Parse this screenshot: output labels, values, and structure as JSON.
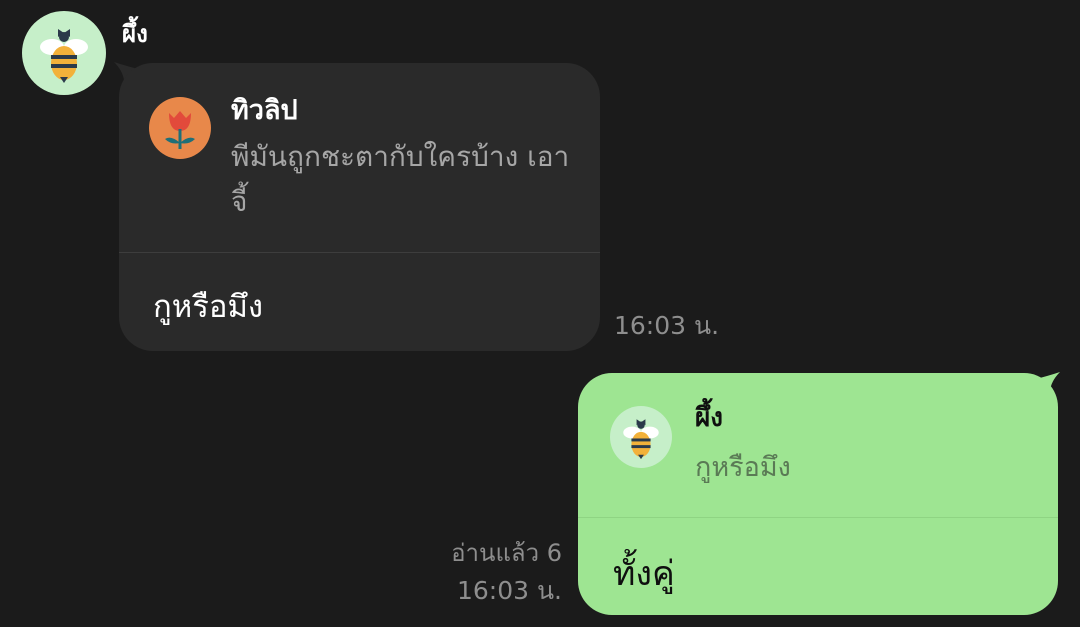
{
  "incoming": {
    "sender": "ผึ้ง",
    "avatar_icon": "bee-icon",
    "quote": {
      "name": "ทิวลิป",
      "text": "พีมันถูกชะตากับใครบ้าง เอาจี้",
      "avatar_icon": "tulip-icon"
    },
    "reply": "กูหรือมึง",
    "time": "16:03 น."
  },
  "outgoing": {
    "quote": {
      "name": "ผึ้ง",
      "text": "กูหรือมึง",
      "avatar_icon": "bee-icon"
    },
    "reply": "ทั้งคู่",
    "read_status": "อ่านแล้ว 6",
    "time": "16:03 น."
  },
  "colors": {
    "background": "#1b1b1b",
    "incoming_bubble": "#2a2a2a",
    "outgoing_bubble": "#9ee592",
    "avatar_bg": "#c6efc9",
    "tulip_bg": "#e8884a"
  }
}
